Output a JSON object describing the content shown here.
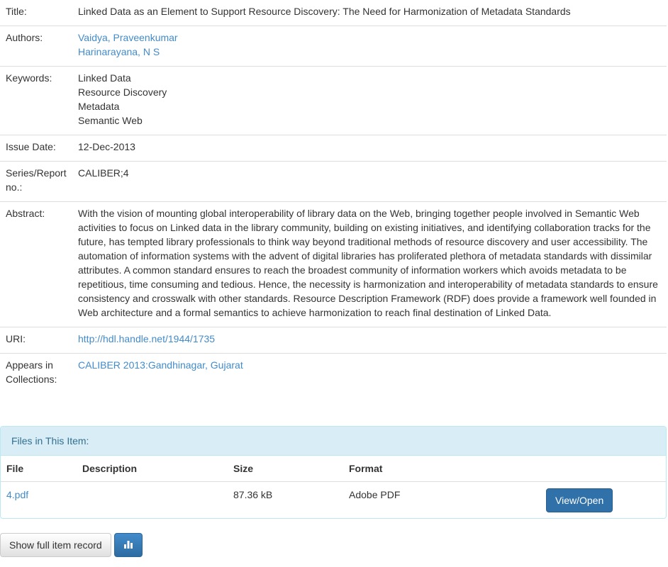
{
  "item": {
    "title_label": "Title:",
    "title": "Linked Data as an Element to Support Resource Discovery: The Need for Harmonization of Metadata Standards",
    "authors_label": "Authors:",
    "authors": [
      "Vaidya, Praveenkumar",
      "Harinarayana, N S"
    ],
    "keywords_label": "Keywords:",
    "keywords": [
      "Linked Data",
      "Resource Discovery",
      "Metadata",
      "Semantic Web"
    ],
    "issue_date_label": "Issue Date:",
    "issue_date": "12-Dec-2013",
    "series_label": "Series/Report no.:",
    "series": "CALIBER;4",
    "abstract_label": "Abstract:",
    "abstract": "With the vision of mounting global interoperability of library data on the Web, bringing together people involved in Semantic Web activities to focus on Linked data in the library community, building on existing initiatives, and identifying collaboration tracks for the future, has tempted library professionals to think way beyond traditional methods of resource discovery and user accessibility. The automation of information systems with the advent of digital libraries has proliferated plethora of metadata standards with dissimilar attributes. A common standard ensures to reach the broadest community of information workers which avoids metadata to be repetitious, time consuming and tedious. Hence, the necessity is harmonization and interoperability of metadata standards to ensure consistency and crosswalk with other standards. Resource Description Framework (RDF) does provide a framework well founded in Web architecture and a formal semantics to achieve harmonization to reach final destination of Linked Data.",
    "uri_label": "URI:",
    "uri": "http://hdl.handle.net/1944/1735",
    "collections_label": "Appears in Collections:",
    "collection": "CALIBER 2013:Gandhinagar, Gujarat"
  },
  "files": {
    "heading": "Files in This Item:",
    "columns": [
      "File",
      "Description",
      "Size",
      "Format"
    ],
    "rows": [
      {
        "file": "4.pdf",
        "description": "",
        "size": "87.36 kB",
        "format": "Adobe PDF",
        "action": "View/Open"
      }
    ]
  },
  "actions": {
    "show_full_record": "Show full item record",
    "stats_icon": "bar-chart-icon"
  },
  "colors": {
    "link": "#428bca",
    "panel_heading_bg": "#d9edf7",
    "primary_button": "#3071a9"
  }
}
